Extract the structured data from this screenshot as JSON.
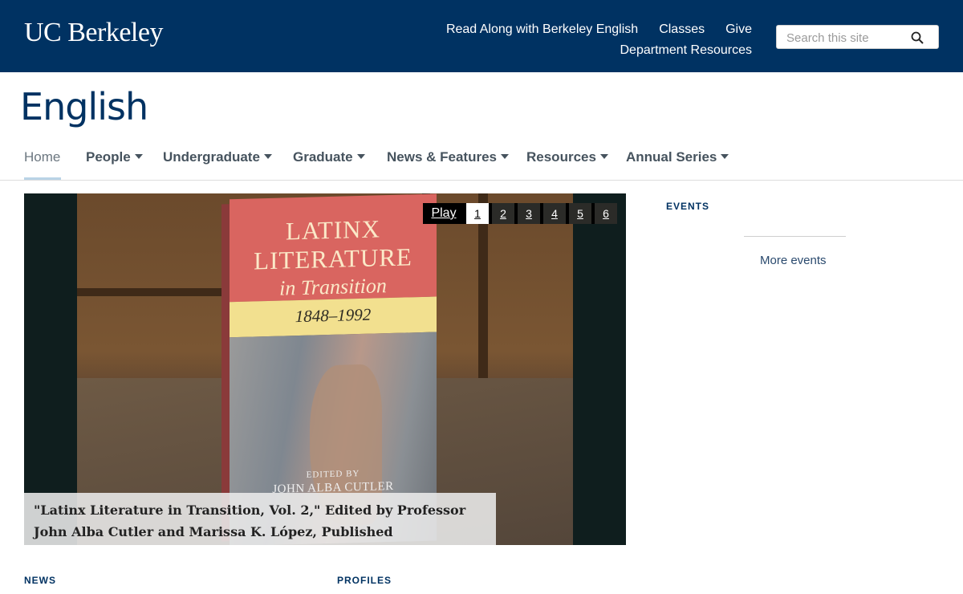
{
  "header": {
    "logo": "UC Berkeley",
    "links_row1": [
      "Read Along with Berkeley English",
      "Classes",
      "Give"
    ],
    "links_row2": [
      "Department Resources"
    ],
    "search_placeholder": "Search this site",
    "search_icon": "search-icon",
    "background": "#003262"
  },
  "site_title": "English",
  "nav": {
    "items": [
      {
        "label": "Home",
        "active": true,
        "dropdown": false
      },
      {
        "label": "People",
        "dropdown": true
      },
      {
        "label": "Undergraduate",
        "dropdown": true
      },
      {
        "label": "Graduate",
        "dropdown": true
      },
      {
        "label": "News & Features",
        "dropdown": true
      },
      {
        "label": "Resources",
        "dropdown": true
      },
      {
        "label": "Annual Series",
        "dropdown": true
      }
    ]
  },
  "slideshow": {
    "play_label": "Play",
    "pages": [
      "1",
      "2",
      "3",
      "4",
      "5",
      "6"
    ],
    "current_page": "1",
    "caption": "\"Latinx Literature in Transition, Vol. 2,\" Edited by Professor John Alba Cutler and Marissa K. López, Published",
    "book": {
      "title_line1": "LATINX",
      "title_line2": "LITERATURE",
      "title_line3": "in Transition",
      "years": "1848–1992",
      "edited_by": "EDITED BY",
      "editors": "JOHN ALBA CUTLER"
    }
  },
  "events": {
    "heading": "EVENTS",
    "more_link": "More events"
  },
  "sections": {
    "news": "NEWS",
    "profiles": "PROFILES"
  }
}
